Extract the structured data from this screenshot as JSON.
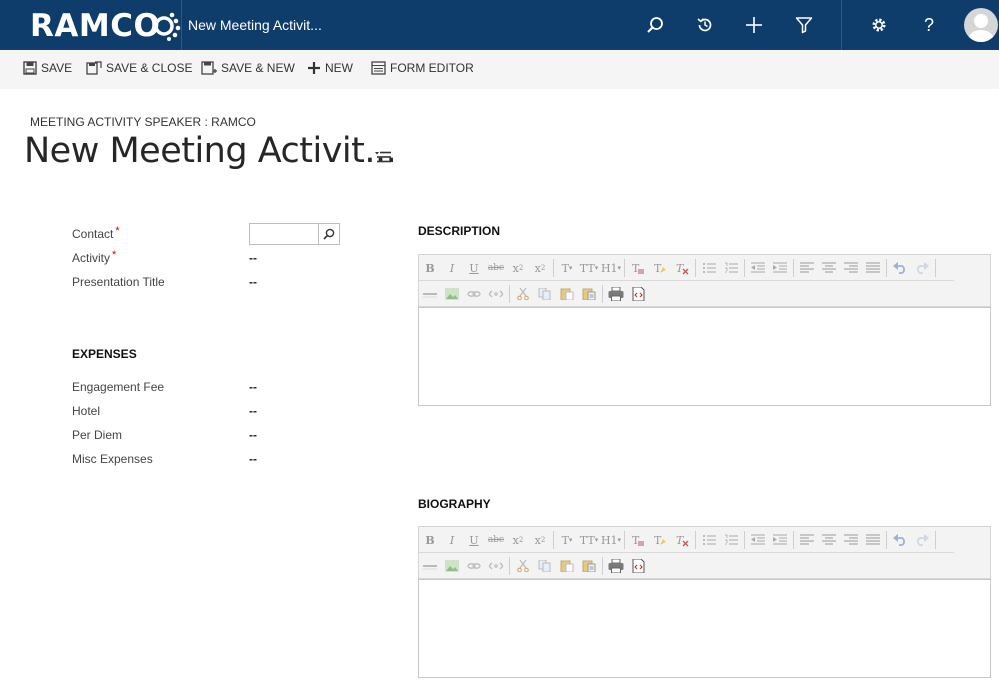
{
  "topbar": {
    "logo_text": "RAMCO",
    "record_title": "New Meeting Activit...",
    "icons": [
      "search-icon",
      "history-icon",
      "plus-icon",
      "filter-icon",
      "gear-icon",
      "help-icon",
      "user-avatar"
    ],
    "help_glyph": "?"
  },
  "commands": {
    "save": "SAVE",
    "save_close": "SAVE & CLOSE",
    "save_new": "SAVE & NEW",
    "new": "NEW",
    "form_editor": "FORM EDITOR"
  },
  "header": {
    "entity_label": "MEETING ACTIVITY SPEAKER : RAMCO",
    "title": "New Meeting Activit..."
  },
  "form": {
    "fields": [
      {
        "label": "Contact",
        "required": "*",
        "value": ""
      },
      {
        "label": "Activity",
        "required": "*",
        "value": "--"
      },
      {
        "label": "Presentation Title",
        "value": "--"
      }
    ],
    "expenses_heading": "EXPENSES",
    "expenses": [
      {
        "label": "Engagement Fee",
        "value": "--"
      },
      {
        "label": "Hotel",
        "value": "--"
      },
      {
        "label": "Per Diem",
        "value": "--"
      },
      {
        "label": "Misc Expenses",
        "value": "--"
      }
    ]
  },
  "description": {
    "heading": "DESCRIPTION"
  },
  "biography": {
    "heading": "BIOGRAPHY"
  },
  "editor_toolbar": {
    "bold": "B",
    "italic": "I",
    "underline": "U",
    "strike": "abc",
    "subscript": "x",
    "superscript": "x",
    "font": "T",
    "font_size": "TT",
    "heading": "H1"
  },
  "colors": {
    "nav_bg": "#0f3d6b",
    "cmd_bg": "#f5f5f5",
    "required": "#d00000"
  }
}
